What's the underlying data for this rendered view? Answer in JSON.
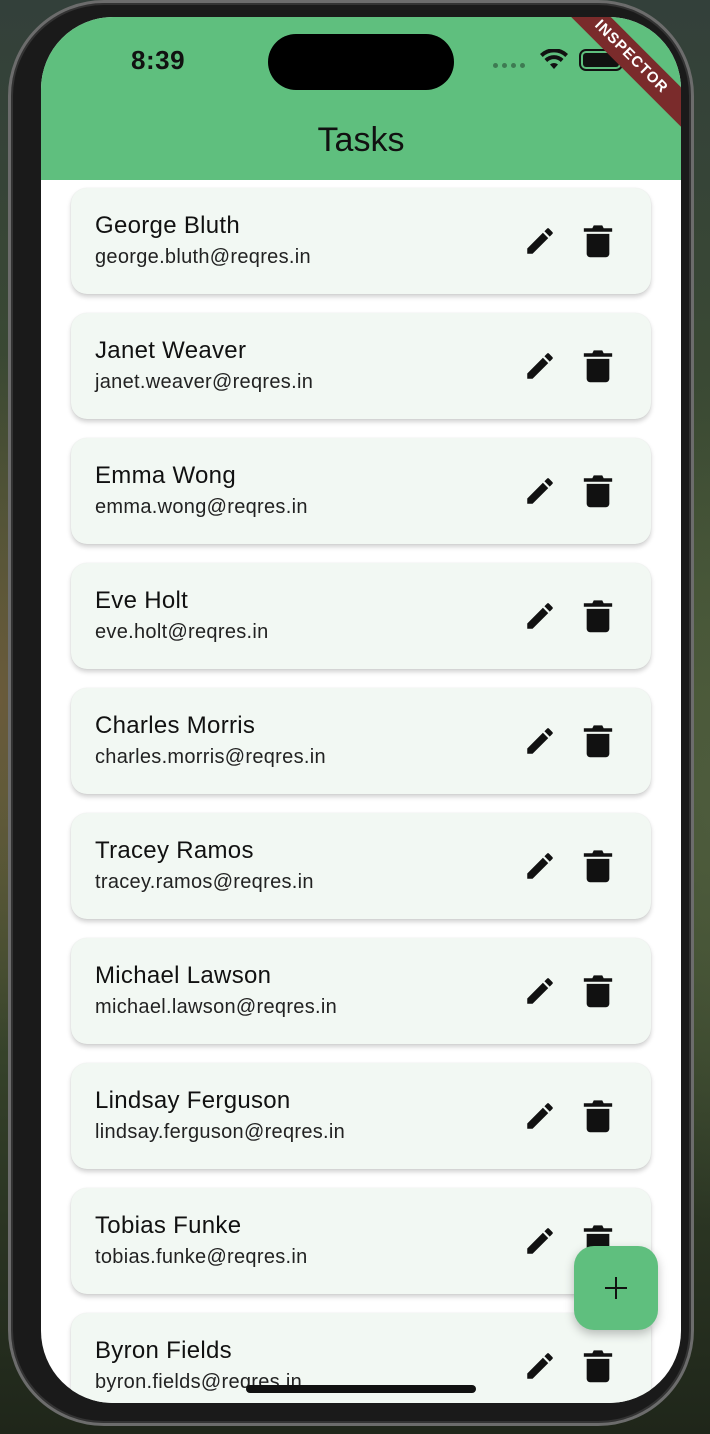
{
  "status_bar": {
    "time": "8:39"
  },
  "debug_banner": {
    "label": "INSPECTOR"
  },
  "app_bar": {
    "title": "Tasks"
  },
  "tasks": [
    {
      "name": "George Bluth",
      "email": "george.bluth@reqres.in"
    },
    {
      "name": "Janet Weaver",
      "email": "janet.weaver@reqres.in"
    },
    {
      "name": "Emma Wong",
      "email": "emma.wong@reqres.in"
    },
    {
      "name": "Eve Holt",
      "email": "eve.holt@reqres.in"
    },
    {
      "name": "Charles Morris",
      "email": "charles.morris@reqres.in"
    },
    {
      "name": "Tracey Ramos",
      "email": "tracey.ramos@reqres.in"
    },
    {
      "name": "Michael Lawson",
      "email": "michael.lawson@reqres.in"
    },
    {
      "name": "Lindsay Ferguson",
      "email": "lindsay.ferguson@reqres.in"
    },
    {
      "name": "Tobias Funke",
      "email": "tobias.funke@reqres.in"
    },
    {
      "name": "Byron Fields",
      "email": "byron.fields@reqres.in"
    }
  ],
  "icons": {
    "edit": "edit-icon",
    "delete": "delete-icon",
    "add": "plus-icon"
  },
  "colors": {
    "primary": "#5fbf7e",
    "card_background": "#f2f8f3",
    "banner": "#7a2b2b"
  }
}
